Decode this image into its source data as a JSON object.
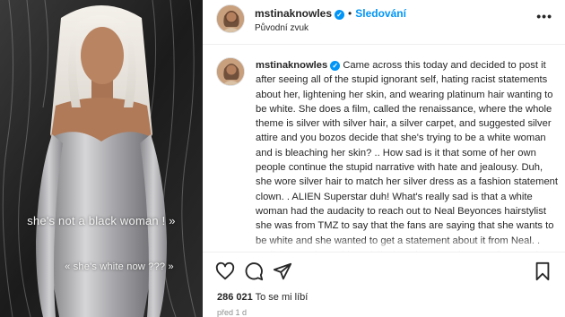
{
  "media": {
    "overlay_line_1": "she's not a black woman ! »",
    "overlay_line_2": "« she's white now ??? »"
  },
  "header": {
    "username": "mstinaknowles",
    "separator": "•",
    "follow_label": "Sledování",
    "audio_label": "Původní zvuk",
    "more_label": "•••"
  },
  "comment": {
    "username": "mstinaknowles",
    "text": "Came across this today and decided to post it after seeing all of the stupid ignorant self, hating racist statements about her, lightening her skin, and wearing platinum hair wanting to be white. She does a film, called the renaissance, where the whole theme is silver with silver hair, a silver carpet, and suggested silver attire and you bozos decide that she's trying to be a white woman and is bleaching her skin? .. How sad is it that some of her own people continue the stupid narrative with hate and jealousy. Duh, she wore silver hair to match her silver dress as a fashion statement clown. . ALIEN Superstar duh! What's really sad is that a white woman had the audacity to reach out to Neal Beyonces hairstylist she was from TMZ to say that the fans are saying that she wants to be white and she wanted to get a statement about it from Neal. . Well that made, and hopefully they don't use that as a factor to hurt her"
  },
  "actions": {
    "like_count": "286 021",
    "like_suffix": "To se mi líbí",
    "timestamp": "před 1 d"
  },
  "icons": {
    "like": "heart-icon",
    "comment": "comment-icon",
    "share": "share-icon",
    "save": "bookmark-icon",
    "verified": "verified-badge-icon"
  },
  "colors": {
    "accent": "#0095f6",
    "text": "#262626",
    "muted": "#8e8e8e"
  }
}
